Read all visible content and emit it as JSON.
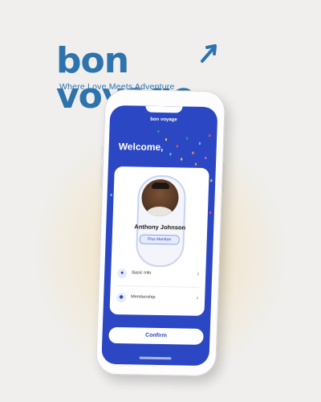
{
  "brand": {
    "name": "bon voyage",
    "name_prefix": "bon voy",
    "name_suffix": "age",
    "tagline": "Where Love Meets Adventure",
    "color": "#2d73ad"
  },
  "app": {
    "logo_text": "bon voyage",
    "welcome": "Welcome,",
    "user_name": "Anthony Johnson",
    "membership_badge": "Plus Member",
    "menu": [
      {
        "label": "Basic Info",
        "icon": "user-icon"
      },
      {
        "label": "Membership",
        "icon": "shield-icon"
      }
    ],
    "confirm_label": "Confirm",
    "accent_color": "#2b47c3"
  }
}
